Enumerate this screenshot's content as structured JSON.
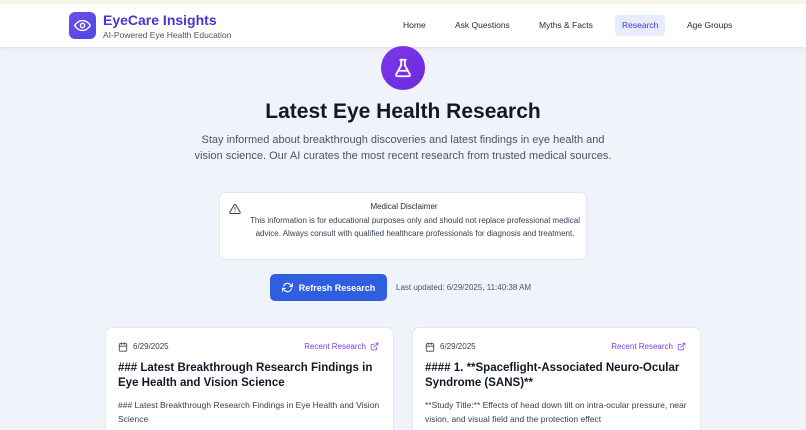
{
  "brand": {
    "title": "EyeCare Insights",
    "subtitle": "AI-Powered Eye Health Education",
    "logo_icon": "eye-icon"
  },
  "nav": [
    {
      "label": "Home",
      "active": false
    },
    {
      "label": "Ask Questions",
      "active": false
    },
    {
      "label": "Myths & Facts",
      "active": false
    },
    {
      "label": "Research",
      "active": true
    },
    {
      "label": "Age Groups",
      "active": false
    }
  ],
  "hero": {
    "icon": "flask-icon",
    "title": "Latest Eye Health Research",
    "description": "Stay informed about breakthrough discoveries and latest findings in eye health and vision science. Our AI curates the most recent research from trusted medical sources."
  },
  "disclaimer": {
    "icon": "warning-icon",
    "title": "Medical Disclaimer",
    "text": "This information is for educational purposes only and should not replace professional medical advice. Always consult with qualified healthcare professionals for diagnosis and treatment."
  },
  "actions": {
    "refresh_label": "Refresh Research",
    "last_updated": "Last updated: 6/29/2025, 11:40:38 AM"
  },
  "cards": [
    {
      "date": "6/29/2025",
      "tag": "Recent Research",
      "title": "### Latest Breakthrough Research Findings in Eye Health and Vision Science",
      "body": "### Latest Breakthrough Research Findings in Eye Health and Vision Science"
    },
    {
      "date": "6/29/2025",
      "tag": "Recent Research",
      "title": "#### 1. **Spaceflight-Associated Neuro-Ocular Syndrome (SANS)**",
      "body": "**Study Title:** Effects of head down tilt on intra-ocular pressure, near vision, and visual field and the protection effect"
    }
  ],
  "colors": {
    "accent": "#4338ca",
    "button": "#2f5ee0",
    "tag": "#7c3aed",
    "background": "#f1f3fa"
  }
}
